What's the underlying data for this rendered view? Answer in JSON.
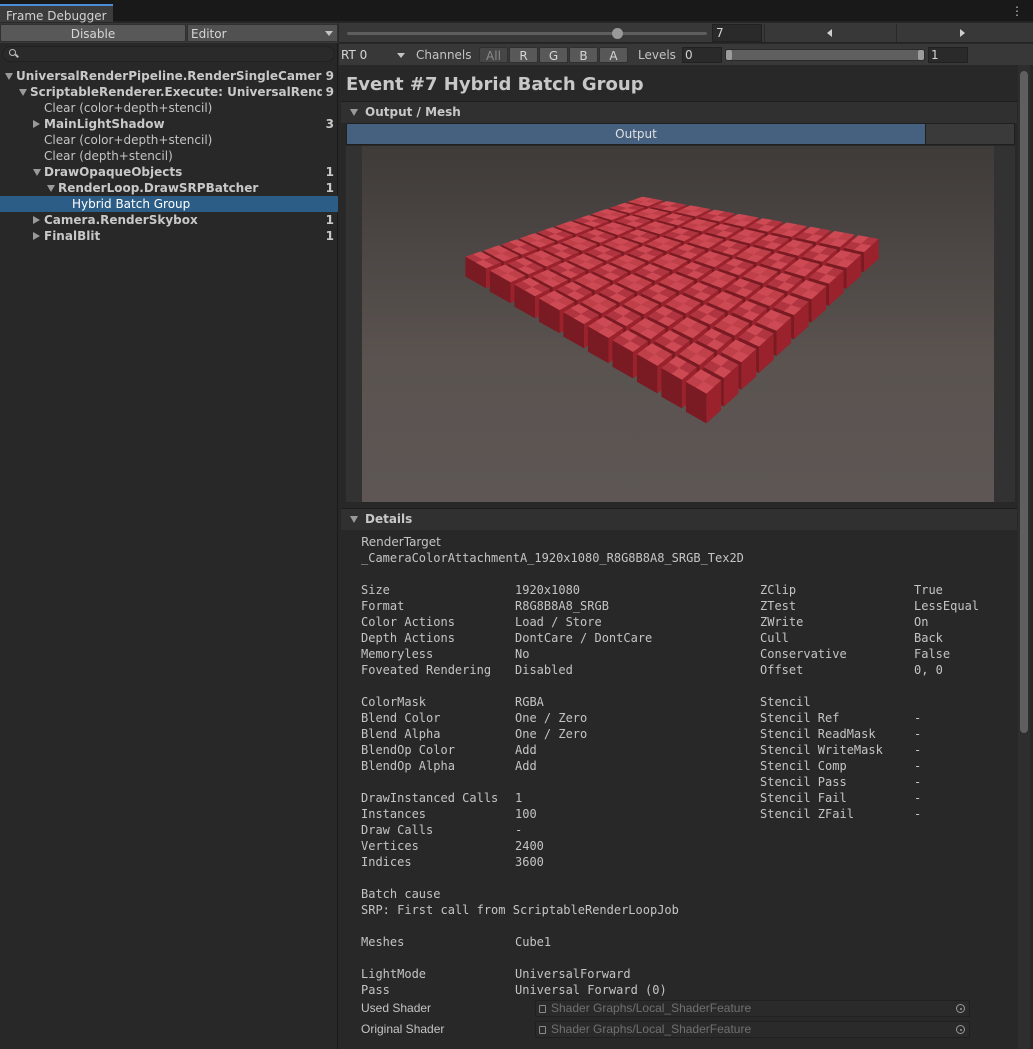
{
  "window": {
    "tab_title": "Frame Debugger",
    "menu_icon": "kebab-menu-icon"
  },
  "toolbar": {
    "disable_label": "Disable",
    "target_dropdown": "Editor",
    "event_index": "7",
    "slider_fraction": 0.75,
    "prev_icon": "triangle-left-icon",
    "next_icon": "triangle-right-icon"
  },
  "search": {
    "value": "",
    "placeholder": ""
  },
  "tree": [
    {
      "label": "UniversalRenderPipeline.RenderSingleCameraInterna",
      "count": "9",
      "depth": 0,
      "state": "open",
      "bold": true
    },
    {
      "label": "ScriptableRenderer.Execute: UniversalRenderPipe",
      "count": "9",
      "depth": 1,
      "state": "open",
      "bold": true
    },
    {
      "label": "Clear (color+depth+stencil)",
      "count": "",
      "depth": 2,
      "state": "leaf",
      "bold": false
    },
    {
      "label": "MainLightShadow",
      "count": "3",
      "depth": 2,
      "state": "closed",
      "bold": true
    },
    {
      "label": "Clear (color+depth+stencil)",
      "count": "",
      "depth": 2,
      "state": "leaf",
      "bold": false
    },
    {
      "label": "Clear (depth+stencil)",
      "count": "",
      "depth": 2,
      "state": "leaf",
      "bold": false
    },
    {
      "label": "DrawOpaqueObjects",
      "count": "1",
      "depth": 2,
      "state": "open",
      "bold": true
    },
    {
      "label": "RenderLoop.DrawSRPBatcher",
      "count": "1",
      "depth": 3,
      "state": "open",
      "bold": true
    },
    {
      "label": "Hybrid Batch Group",
      "count": "",
      "depth": 4,
      "state": "leaf",
      "bold": false,
      "selected": true
    },
    {
      "label": "Camera.RenderSkybox",
      "count": "1",
      "depth": 2,
      "state": "closed",
      "bold": true
    },
    {
      "label": "FinalBlit",
      "count": "1",
      "depth": 2,
      "state": "closed",
      "bold": true
    }
  ],
  "rt_bar": {
    "rt_dropdown": "RT 0",
    "channels_label": "Channels",
    "channels": [
      "All",
      "R",
      "G",
      "B",
      "A"
    ],
    "levels_label": "Levels",
    "levels_min": "0",
    "levels_max": "1"
  },
  "event": {
    "title": "Event #7 Hybrid Batch Group",
    "output_section": "Output / Mesh",
    "output_tab": "Output",
    "details_section": "Details",
    "render_target_label": "RenderTarget",
    "render_target_value": "_CameraColorAttachmentA_1920x1080_R8G8B8A8_SRGB_Tex2D"
  },
  "grid": {
    "rows": 10,
    "cols": 10,
    "cube_color": "#b0303a"
  },
  "details_left": [
    {
      "k": "Size",
      "v": "1920x1080"
    },
    {
      "k": "Format",
      "v": "R8G8B8A8_SRGB"
    },
    {
      "k": "Color Actions",
      "v": "Load / Store"
    },
    {
      "k": "Depth Actions",
      "v": "DontCare / DontCare"
    },
    {
      "k": "Memoryless",
      "v": "No"
    },
    {
      "k": "Foveated Rendering",
      "v": "Disabled"
    }
  ],
  "details_right": [
    {
      "k": "ZClip",
      "v": "True"
    },
    {
      "k": "ZTest",
      "v": "LessEqual"
    },
    {
      "k": "ZWrite",
      "v": "On"
    },
    {
      "k": "Cull",
      "v": "Back"
    },
    {
      "k": "Conservative",
      "v": "False"
    },
    {
      "k": "Offset",
      "v": "0, 0"
    }
  ],
  "blend_left": [
    {
      "k": "ColorMask",
      "v": "RGBA"
    },
    {
      "k": "Blend Color",
      "v": "One / Zero"
    },
    {
      "k": "Blend Alpha",
      "v": "One / Zero"
    },
    {
      "k": "BlendOp Color",
      "v": "Add"
    },
    {
      "k": "BlendOp Alpha",
      "v": "Add"
    }
  ],
  "stencil_right": [
    {
      "k": "Stencil",
      "v": ""
    },
    {
      "k": "Stencil Ref",
      "v": "-"
    },
    {
      "k": "Stencil ReadMask",
      "v": "-"
    },
    {
      "k": "Stencil WriteMask",
      "v": "-"
    },
    {
      "k": "Stencil Comp",
      "v": "-"
    },
    {
      "k": "Stencil Pass",
      "v": "-"
    },
    {
      "k": "Stencil Fail",
      "v": "-"
    },
    {
      "k": "Stencil ZFail",
      "v": "-"
    }
  ],
  "draw_stats": [
    {
      "k": "DrawInstanced Calls",
      "v": "1"
    },
    {
      "k": "Instances",
      "v": "100"
    },
    {
      "k": "Draw Calls",
      "v": "-"
    },
    {
      "k": "Vertices",
      "v": "2400"
    },
    {
      "k": "Indices",
      "v": "3600"
    }
  ],
  "batch": {
    "label": "Batch cause",
    "value": "SRP: First call from ScriptableRenderLoopJob"
  },
  "meshes": {
    "k": "Meshes",
    "v": "Cube1"
  },
  "lightmode": {
    "k": "LightMode",
    "v": "UniversalForward"
  },
  "pass": {
    "k": "Pass",
    "v": "Universal Forward (0)"
  },
  "used_shader": {
    "k": "Used Shader",
    "v": "Shader Graphs/Local_ShaderFeature"
  },
  "original_shader": {
    "k": "Original Shader",
    "v": "Shader Graphs/Local_ShaderFeature"
  }
}
